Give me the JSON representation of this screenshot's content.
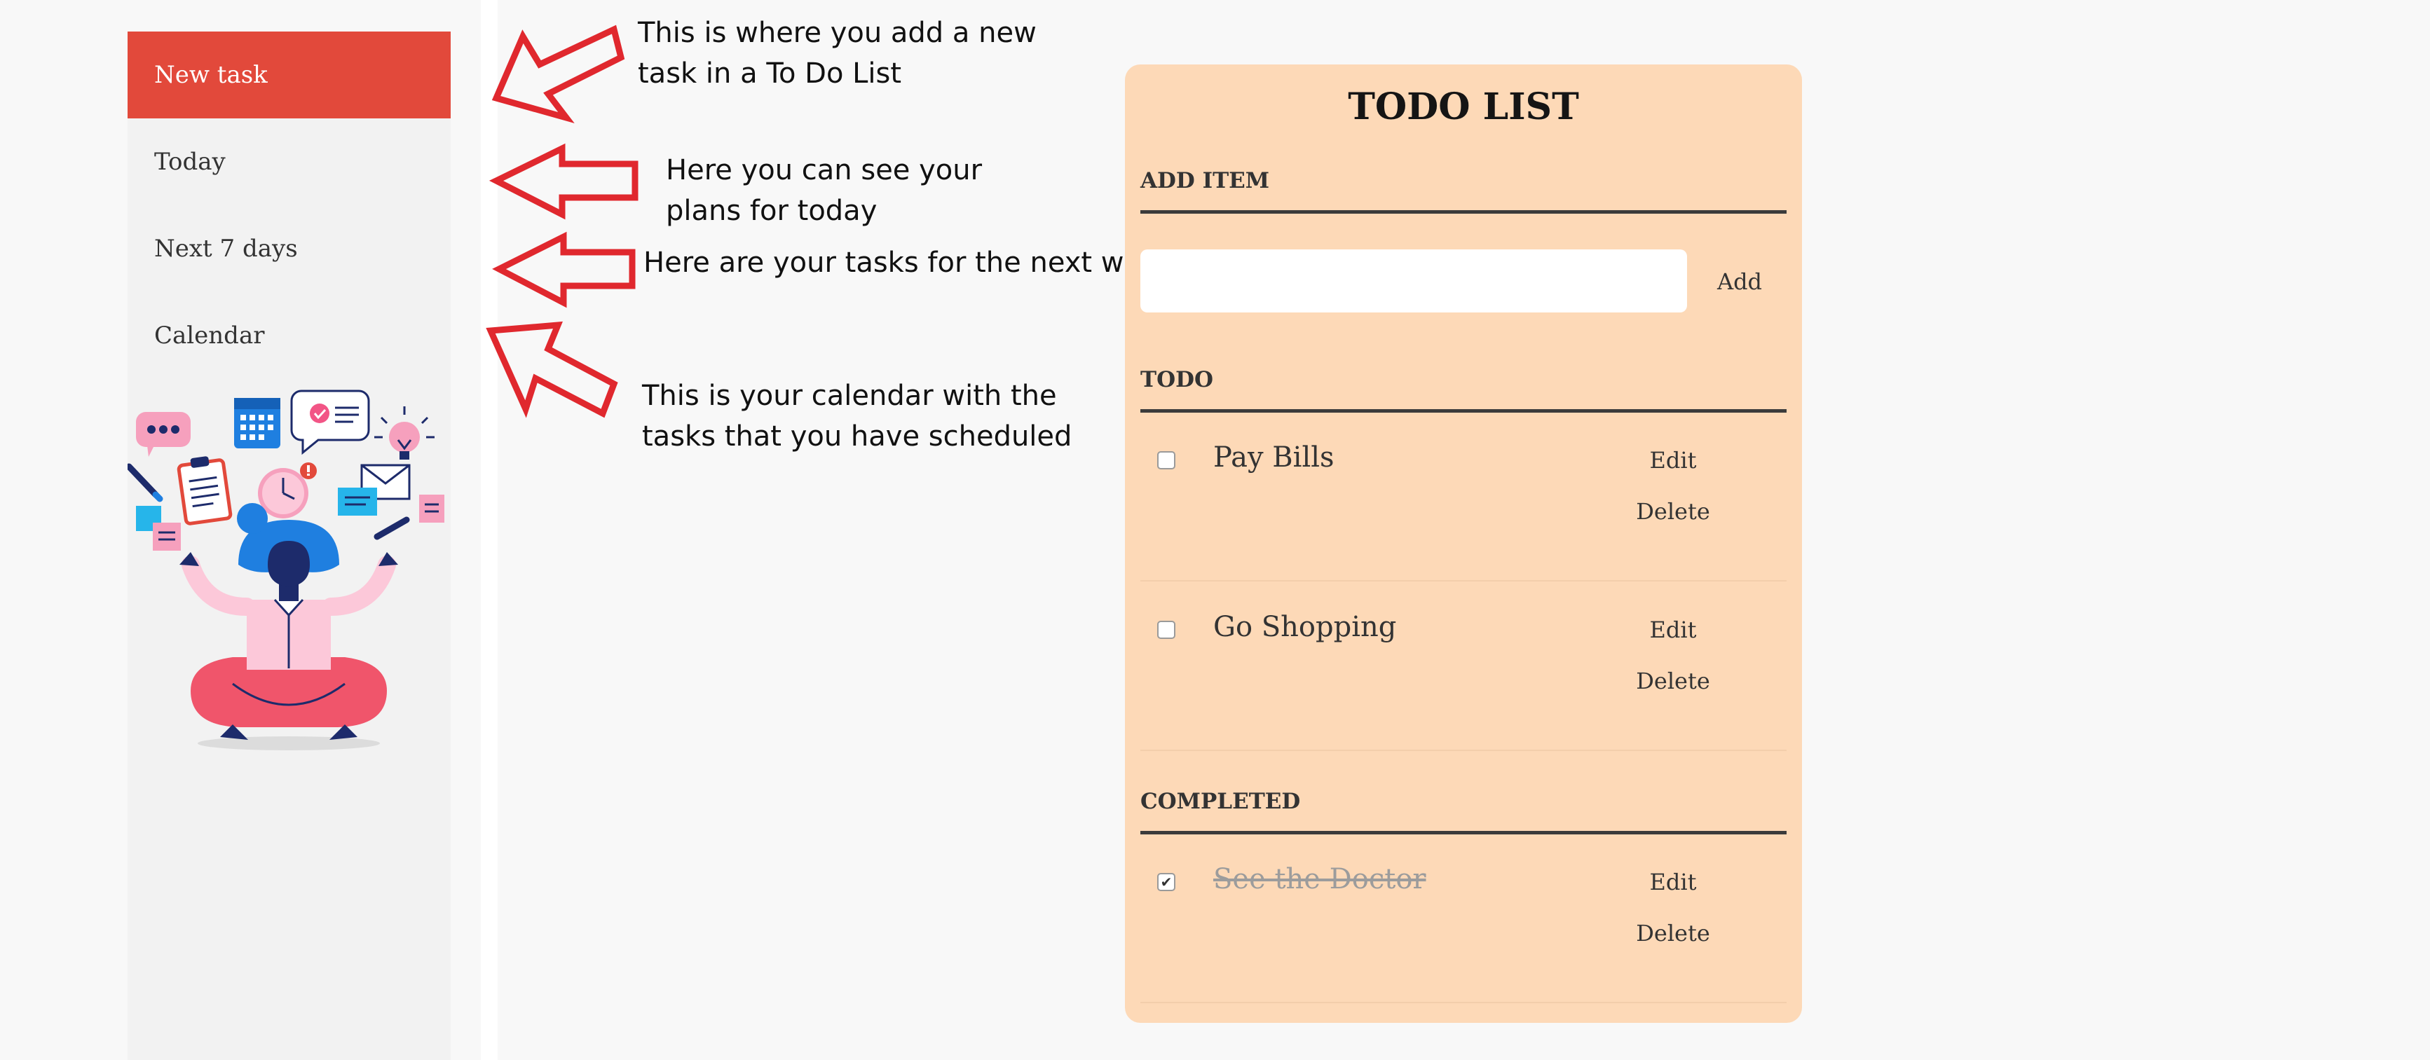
{
  "sidebar": {
    "items": [
      {
        "label": "New task",
        "active": true
      },
      {
        "label": "Today",
        "active": false
      },
      {
        "label": "Next 7 days",
        "active": false
      },
      {
        "label": "Calendar",
        "active": false
      }
    ]
  },
  "annotations": [
    {
      "line1": "This is where you add a new",
      "line2": "task in a To Do List"
    },
    {
      "line1": "Here you can see your",
      "line2": "plans for today"
    },
    {
      "line1": "Here are your tasks for the next week",
      "line2": ""
    },
    {
      "line1": "This is your calendar with the",
      "line2": "tasks that you have scheduled"
    }
  ],
  "todo": {
    "title": "TODO LIST",
    "add_section_label": "ADD ITEM",
    "add_input_value": "",
    "add_button_label": "Add",
    "todo_section_label": "TODO",
    "completed_section_label": "COMPLETED",
    "tasks": [
      {
        "name": "Pay Bills",
        "edit_label": "Edit",
        "delete_label": "Delete",
        "checked": false
      },
      {
        "name": "Go Shopping",
        "edit_label": "Edit",
        "delete_label": "Delete",
        "checked": false
      }
    ],
    "completed": [
      {
        "name": "See the Doctor",
        "edit_label": "Edit",
        "delete_label": "Delete",
        "checked": true,
        "checkmark": "✔"
      }
    ]
  },
  "colors": {
    "active_item_bg": "#e2493b",
    "card_bg": "#fdd9b7",
    "arrow_stroke": "#e0282e"
  }
}
